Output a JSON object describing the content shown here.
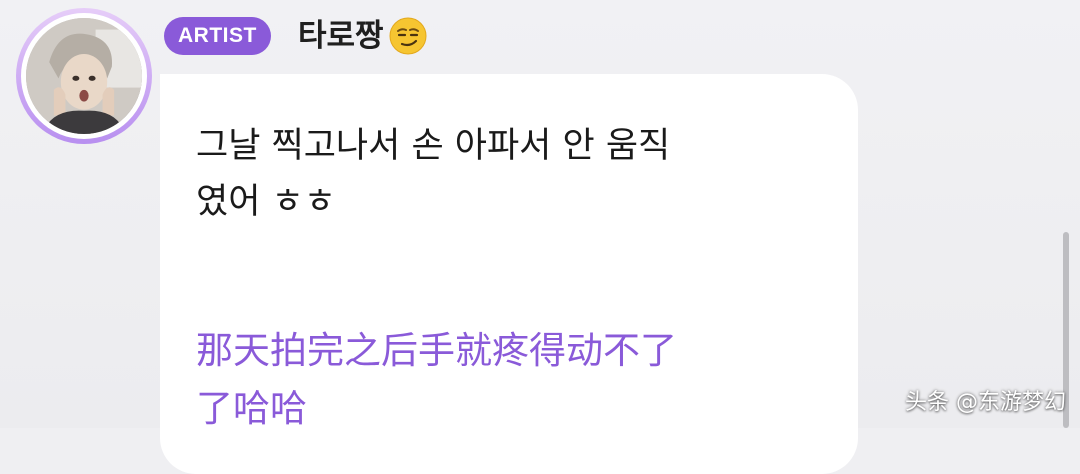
{
  "post": {
    "badge_label": "ARTIST",
    "author_name": "타로짱",
    "author_emoji_icon": "smirking-face-icon",
    "message_korean_line1": "그날 찍고나서 손 아파서 안 움직",
    "message_korean_line2": "였어 ㅎㅎ",
    "message_translation_line1": "那天拍完之后手就疼得动不了",
    "message_translation_line2": "了哈哈"
  },
  "watermark": {
    "text": "头条 @东游梦幻"
  },
  "colors": {
    "accent": "#8a5ad9",
    "background": "#efeff2",
    "bubble": "#ffffff",
    "text": "#1a1a1a"
  }
}
